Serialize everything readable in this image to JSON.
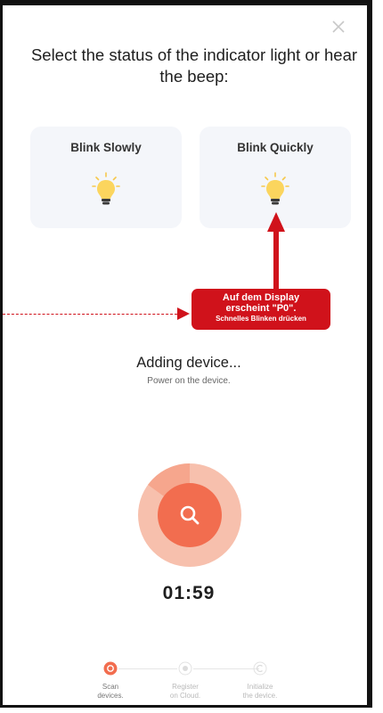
{
  "header": {
    "title": "Select the status of the indicator light or hear the beep:",
    "close_icon": "close-icon"
  },
  "options": {
    "blink_slowly": {
      "label": "Blink Slowly",
      "icon": "lightbulb-icon"
    },
    "blink_quickly": {
      "label": "Blink Quickly",
      "icon": "lightbulb-icon"
    }
  },
  "annotation": {
    "line1": "Auf dem Display",
    "line2": "erscheint \"P0\".",
    "line3": "Schnelles Blinken drücken",
    "color": "#d0121b"
  },
  "status": {
    "title": "Adding device...",
    "subtitle": "Power on the device.",
    "timer": "01:59",
    "progress": 0.15,
    "accent": "#f26d4f"
  },
  "steps": [
    {
      "label_line1": "Scan",
      "label_line2": "devices.",
      "active": true
    },
    {
      "label_line1": "Register",
      "label_line2": "on Cloud.",
      "active": false
    },
    {
      "label_line1": "Initialize",
      "label_line2": "the device.",
      "active": false
    }
  ]
}
